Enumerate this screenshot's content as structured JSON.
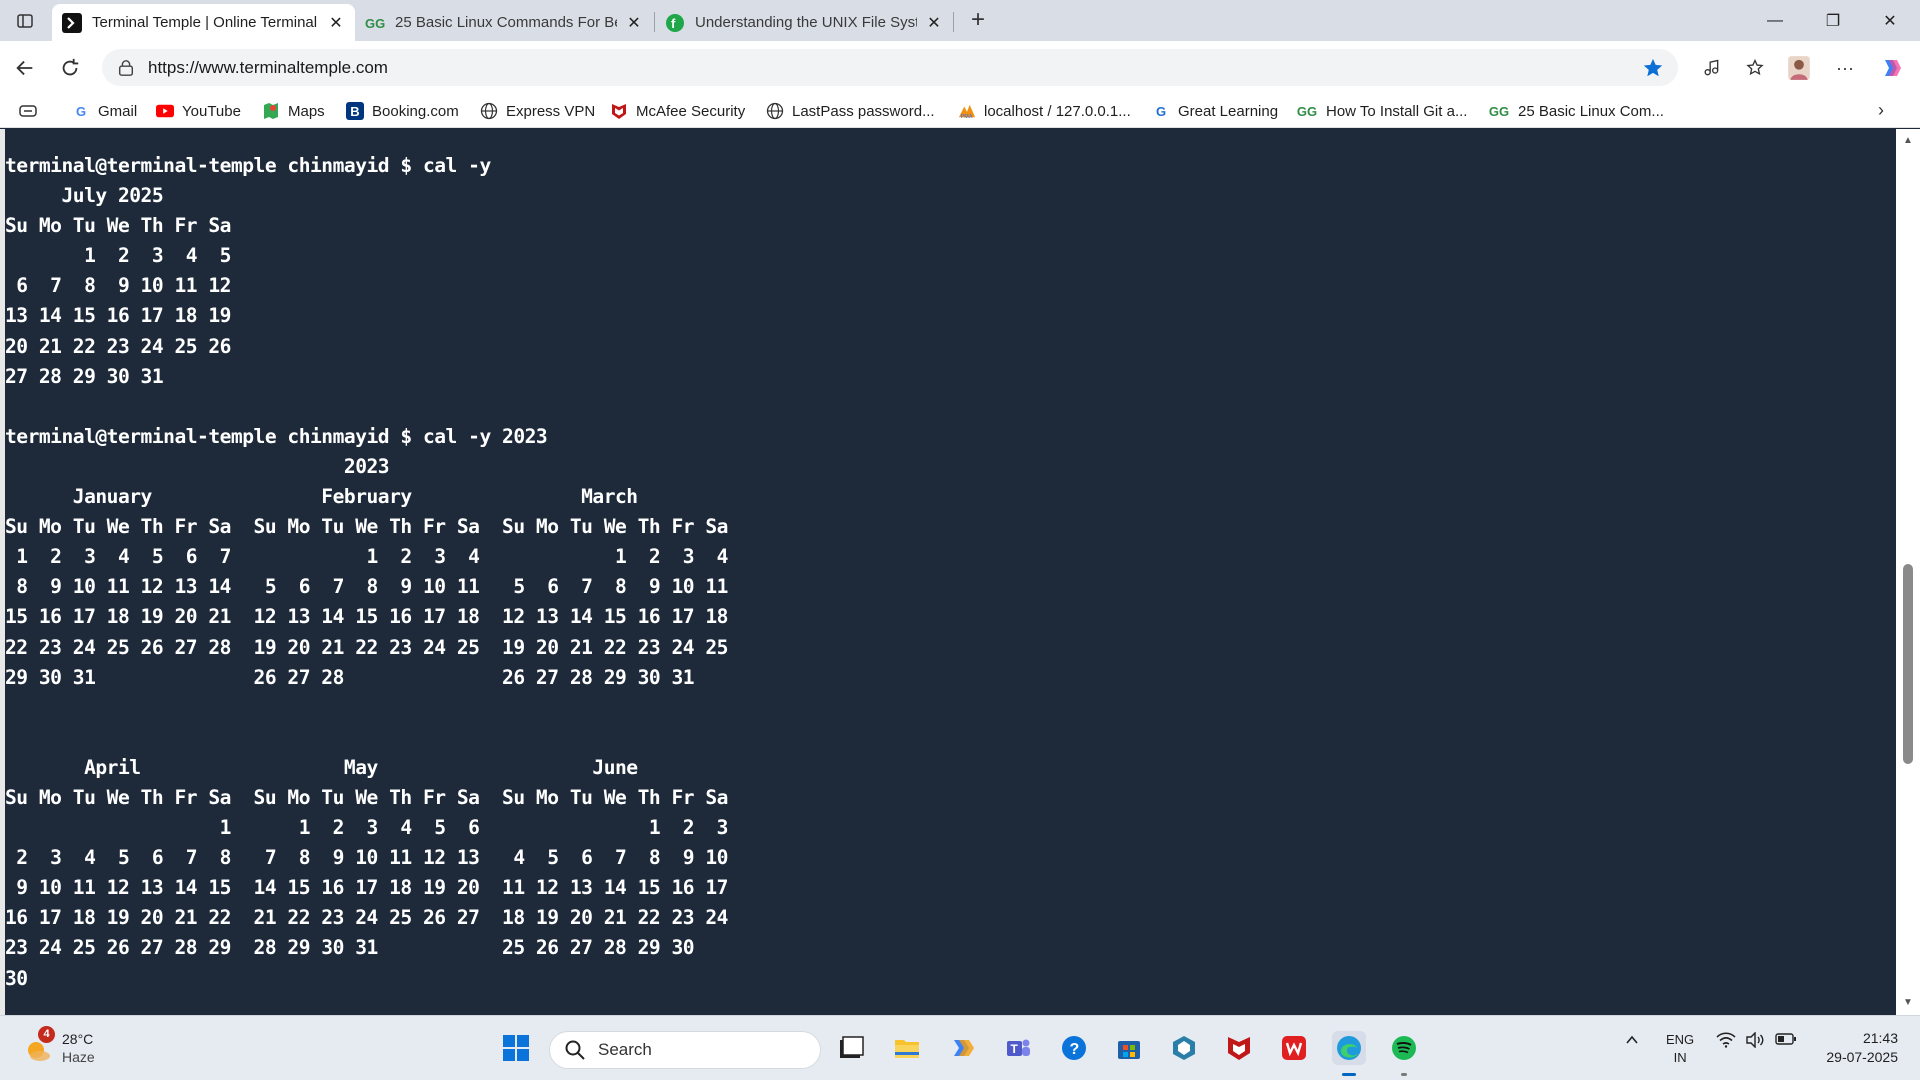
{
  "browser": {
    "tabs": [
      {
        "title": "Terminal Temple | Online Terminal",
        "active": true
      },
      {
        "title": "25 Basic Linux Commands For Beginners",
        "active": false
      },
      {
        "title": "Understanding the UNIX File System",
        "active": false
      }
    ],
    "url": "https://www.terminaltemple.com"
  },
  "bookmarks": [
    {
      "label": "Gmail"
    },
    {
      "label": "YouTube"
    },
    {
      "label": "Maps"
    },
    {
      "label": "Booking.com"
    },
    {
      "label": "Express VPN"
    },
    {
      "label": "McAfee Security"
    },
    {
      "label": "LastPass password..."
    },
    {
      "label": "localhost / 127.0.0.1..."
    },
    {
      "label": "Great Learning"
    },
    {
      "label": "How To Install Git a..."
    },
    {
      "label": "25 Basic Linux Com..."
    }
  ],
  "terminal": {
    "output": "terminal@terminal-temple chinmayid $ cal -y\n     July 2025\nSu Mo Tu We Th Fr Sa\n       1  2  3  4  5\n 6  7  8  9 10 11 12\n13 14 15 16 17 18 19\n20 21 22 23 24 25 26\n27 28 29 30 31\n\nterminal@terminal-temple chinmayid $ cal -y 2023\n                              2023\n      January               February               March\nSu Mo Tu We Th Fr Sa  Su Mo Tu We Th Fr Sa  Su Mo Tu We Th Fr Sa\n 1  2  3  4  5  6  7            1  2  3  4            1  2  3  4\n 8  9 10 11 12 13 14   5  6  7  8  9 10 11   5  6  7  8  9 10 11\n15 16 17 18 19 20 21  12 13 14 15 16 17 18  12 13 14 15 16 17 18\n22 23 24 25 26 27 28  19 20 21 22 23 24 25  19 20 21 22 23 24 25\n29 30 31              26 27 28              26 27 28 29 30 31\n\n\n       April                  May                   June\nSu Mo Tu We Th Fr Sa  Su Mo Tu We Th Fr Sa  Su Mo Tu We Th Fr Sa\n                   1      1  2  3  4  5  6               1  2  3\n 2  3  4  5  6  7  8   7  8  9 10 11 12 13   4  5  6  7  8  9 10\n 9 10 11 12 13 14 15  14 15 16 17 18 19 20  11 12 13 14 15 16 17\n16 17 18 19 20 21 22  21 22 23 24 25 26 27  18 19 20 21 22 23 24\n23 24 25 26 27 28 29  28 29 30 31           25 26 27 28 29 30\n30"
  },
  "taskbar": {
    "weather": {
      "temp": "28°C",
      "condition": "Haze",
      "badge": "4"
    },
    "search_label": "Search",
    "language": {
      "line1": "ENG",
      "line2": "IN"
    },
    "time": "21:43",
    "date": "29-07-2025"
  },
  "colors": {
    "terminal_bg": "#1e2a3a",
    "terminal_fg": "#ffffff",
    "accent": "#0067c0"
  }
}
